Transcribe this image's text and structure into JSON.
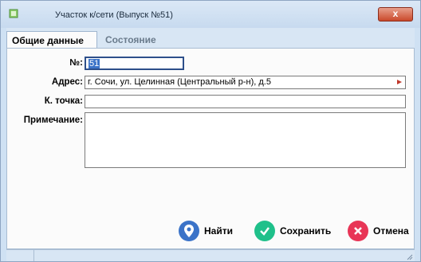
{
  "window": {
    "title": "Участок к/сети (Выпуск №51)",
    "close_label": "x"
  },
  "tabs": [
    {
      "label": "Общие данные"
    },
    {
      "label": "Состояние"
    }
  ],
  "form": {
    "number_label": "№:",
    "number_value": "51",
    "address_label": "Адрес:",
    "address_value": "г. Сочи, ул. Целинная (Центральный р-н), д.5",
    "point_label": "К. точка:",
    "point_value": "",
    "note_label": "Примечание:",
    "note_value": ""
  },
  "buttons": {
    "find": "Найти",
    "save": "Сохранить",
    "cancel": "Отмена"
  },
  "icons": {
    "app": "app-icon",
    "address_dropdown": "arrow-icon",
    "find": "map-marker-icon",
    "save": "check-icon",
    "cancel": "close-icon"
  },
  "colors": {
    "save": "#1fc08a",
    "cancel": "#e83556",
    "find": "#3b73c8"
  }
}
